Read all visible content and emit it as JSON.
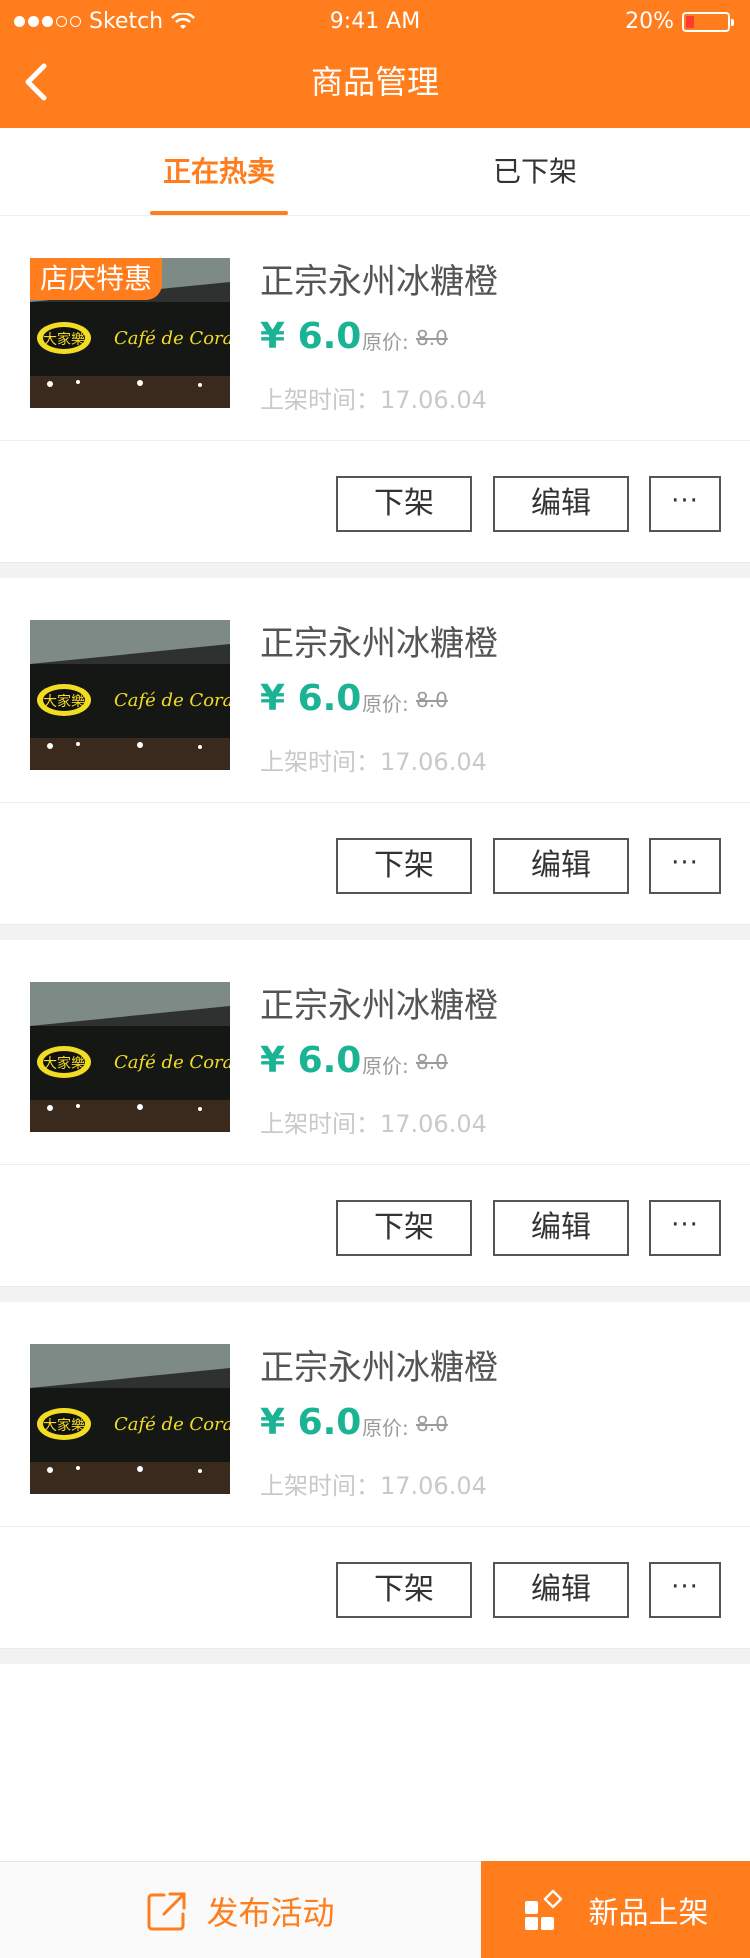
{
  "status": {
    "carrier": "Sketch",
    "time": "9:41 AM",
    "battery": "20%",
    "colors": {
      "bar": "#ff7d1c",
      "battery_fill": "#ff3b30"
    }
  },
  "nav": {
    "title": "商品管理",
    "back_icon": "chevron-left-icon"
  },
  "tabs": [
    {
      "label": "正在热卖",
      "active": true
    },
    {
      "label": "已下架",
      "active": false
    }
  ],
  "products": [
    {
      "promo": "店庆特惠",
      "name": "正宗永州冰糖橙",
      "price": "¥ 6.0",
      "orig_label": "原价:",
      "orig_price": "8.0",
      "time": "上架时间：17.06.04",
      "img_text": "Café de Coral.",
      "logo_text": "大家樂"
    },
    {
      "promo": "",
      "name": "正宗永州冰糖橙",
      "price": "¥ 6.0",
      "orig_label": "原价:",
      "orig_price": "8.0",
      "time": "上架时间：17.06.04",
      "img_text": "Café de Coral.",
      "logo_text": "大家樂"
    },
    {
      "promo": "",
      "name": "正宗永州冰糖橙",
      "price": "¥ 6.0",
      "orig_label": "原价:",
      "orig_price": "8.0",
      "time": "上架时间：17.06.04",
      "img_text": "Café de Coral.",
      "logo_text": "大家樂"
    },
    {
      "promo": "",
      "name": "正宗永州冰糖橙",
      "price": "¥ 6.0",
      "orig_label": "原价:",
      "orig_price": "8.0",
      "time": "上架时间：17.06.04",
      "img_text": "Café de Coral.",
      "logo_text": "大家樂"
    }
  ],
  "actions": {
    "unlist": "下架",
    "edit": "编辑",
    "more": "···"
  },
  "bottom": {
    "publish": "发布活动",
    "new_product": "新品上架"
  },
  "colors": {
    "accent": "#ff7d1c",
    "price": "#1ab394"
  }
}
